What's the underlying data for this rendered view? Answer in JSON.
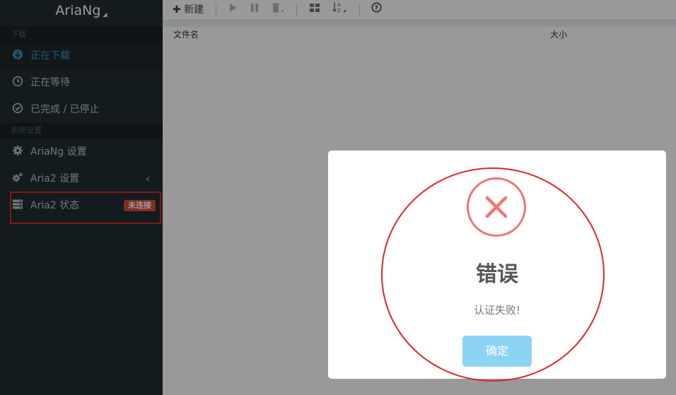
{
  "app": {
    "title": "AriaNg"
  },
  "sidebar": {
    "section_download": "下载",
    "items_download": [
      {
        "label": "正在下载",
        "icon": "download-circle-icon",
        "active": true
      },
      {
        "label": "正在等待",
        "icon": "clock-icon"
      },
      {
        "label": "已完成 / 已停止",
        "icon": "check-circle-icon"
      }
    ],
    "section_settings": "系统设置",
    "items_settings": [
      {
        "label": "AriaNg 设置",
        "icon": "gear-icon"
      },
      {
        "label": "Aria2 设置",
        "icon": "gears-icon"
      },
      {
        "label": "Aria2 状态",
        "icon": "server-icon",
        "badge": "未连接"
      }
    ]
  },
  "toolbar": {
    "new_label": "新建"
  },
  "table": {
    "col_name": "文件名",
    "col_size": "大小"
  },
  "dialog": {
    "title": "错误",
    "message": "认证失败!",
    "confirm_label": "确定"
  },
  "colors": {
    "sidebar_bg": "#222d32",
    "active_blue": "#3c8dbc",
    "badge_red": "#dd4b39",
    "error_red": "#f27474",
    "confirm_button": "#8cd4f5",
    "annotation_red": "#e0262a"
  }
}
